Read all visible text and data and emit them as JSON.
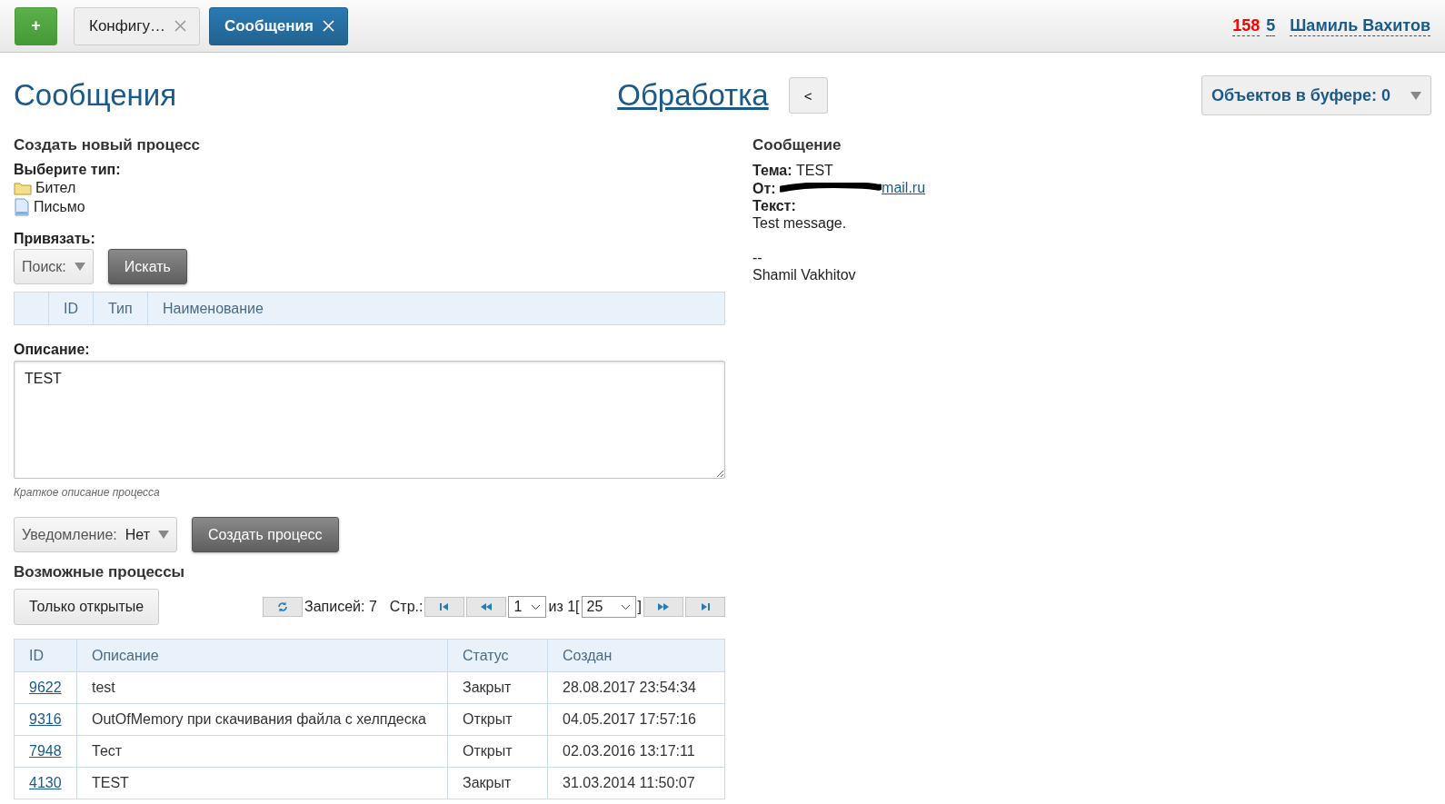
{
  "topbar": {
    "add_button": "+",
    "tabs": [
      {
        "label": "Конфигу…",
        "selected": false
      },
      {
        "label": "Сообщения",
        "selected": true
      }
    ],
    "counters": [
      {
        "text": "158",
        "color": "#ff0000"
      },
      {
        "text": "5",
        "color": "#1a5a8a"
      }
    ],
    "user": "Шамиль Вахитов"
  },
  "header": {
    "title": "Сообщения",
    "center_link": "Обработка",
    "back_button": "<",
    "buffer": "Объектов в буфере: 0"
  },
  "create": {
    "heading": "Создать новый процесс",
    "type_label": "Выберите тип:",
    "types": [
      {
        "label": "Бител",
        "kind": "folder"
      },
      {
        "label": "Письмо",
        "kind": "document"
      }
    ],
    "bind_label": "Привязать:",
    "search_select": "Поиск:",
    "search_button": "Искать",
    "bind_columns": [
      "ID",
      "Тип",
      "Наименование"
    ],
    "description_label": "Описание:",
    "description_value": "TEST",
    "description_hint": "Краткое описание процесса",
    "notify_label": "Уведомление:",
    "notify_value": "Нет",
    "create_button": "Создать процесс"
  },
  "processes": {
    "heading": "Возможные процессы",
    "filter_button": "Только открытые",
    "records": "Записей: 7",
    "page_label": "Стр.:",
    "page": "1",
    "of_text": "из 1[",
    "page_size": "25",
    "close_bracket": "]",
    "columns": [
      "ID",
      "Описание",
      "Статус",
      "Создан"
    ],
    "rows": [
      {
        "id": "9622",
        "description": "test",
        "status": "Закрыт",
        "created": "28.08.2017 23:54:34"
      },
      {
        "id": "9316",
        "description": "OutOfMemory при скачивания файла с хелпдеска",
        "status": "Открыт",
        "created": "04.05.2017 17:57:16"
      },
      {
        "id": "7948",
        "description": "Тест",
        "status": "Открыт",
        "created": "02.03.2016 13:17:11"
      },
      {
        "id": "4130",
        "description": "TEST",
        "status": "Закрыт",
        "created": "31.03.2014 11:50:07"
      }
    ]
  },
  "message": {
    "heading": "Сообщение",
    "subject_label": "Тема:",
    "subject": "TEST",
    "from_label": "От:",
    "from": "mail.ru",
    "text_label": "Текст:",
    "body": [
      "Test message.",
      "--\nShamil Vakhitov"
    ]
  }
}
